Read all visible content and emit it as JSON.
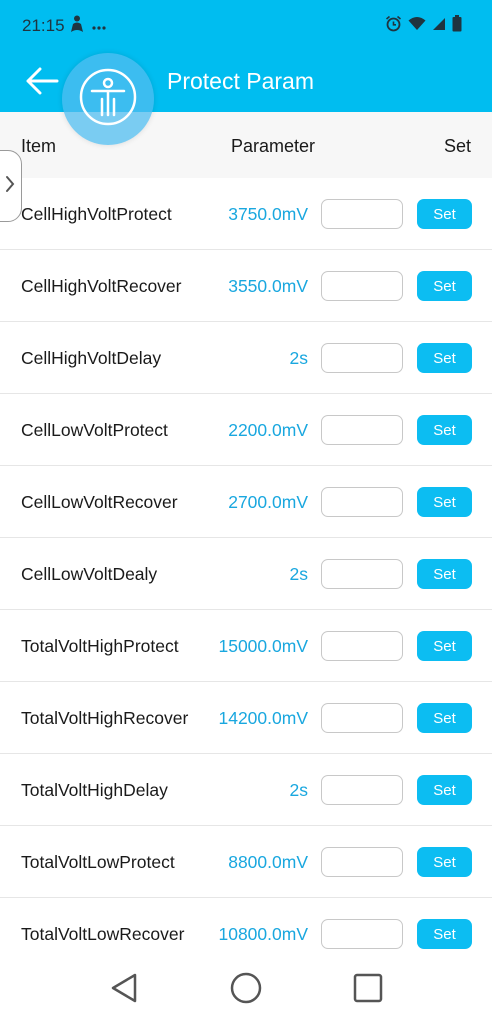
{
  "status_bar": {
    "time": "21:15",
    "left_icons": [
      "person-icon",
      "more-icon"
    ],
    "right_icons": [
      "alarm-icon",
      "wifi-icon",
      "signal-icon",
      "battery-icon"
    ]
  },
  "app_bar": {
    "title": "Protect Param",
    "back_icon": "back-arrow-icon",
    "overlay_icon": "accessibility-icon"
  },
  "table_header": {
    "item": "Item",
    "parameter": "Parameter",
    "set": "Set"
  },
  "rows": [
    {
      "label": "CellHighVoltProtect",
      "value": "3750.0mV",
      "input_value": "",
      "set_label": "Set"
    },
    {
      "label": "CellHighVoltRecover",
      "value": "3550.0mV",
      "input_value": "",
      "set_label": "Set"
    },
    {
      "label": "CellHighVoltDelay",
      "value": "2s",
      "input_value": "",
      "set_label": "Set"
    },
    {
      "label": "CellLowVoltProtect",
      "value": "2200.0mV",
      "input_value": "",
      "set_label": "Set"
    },
    {
      "label": "CellLowVoltRecover",
      "value": "2700.0mV",
      "input_value": "",
      "set_label": "Set"
    },
    {
      "label": "CellLowVoltDealy",
      "value": "2s",
      "input_value": "",
      "set_label": "Set"
    },
    {
      "label": "TotalVoltHighProtect",
      "value": "15000.0mV",
      "input_value": "",
      "set_label": "Set"
    },
    {
      "label": "TotalVoltHighRecover",
      "value": "14200.0mV",
      "input_value": "",
      "set_label": "Set"
    },
    {
      "label": "TotalVoltHighDelay",
      "value": "2s",
      "input_value": "",
      "set_label": "Set"
    },
    {
      "label": "TotalVoltLowProtect",
      "value": "8800.0mV",
      "input_value": "",
      "set_label": "Set"
    },
    {
      "label": "TotalVoltLowRecover",
      "value": "10800.0mV",
      "input_value": "",
      "set_label": "Set"
    }
  ],
  "nav_bar": {
    "icons": [
      "nav-back-icon",
      "nav-home-icon",
      "nav-recents-icon"
    ]
  },
  "colors": {
    "accent": "#00bdf0",
    "value_text": "#19a7df",
    "set_button": "#0cbdf2"
  }
}
